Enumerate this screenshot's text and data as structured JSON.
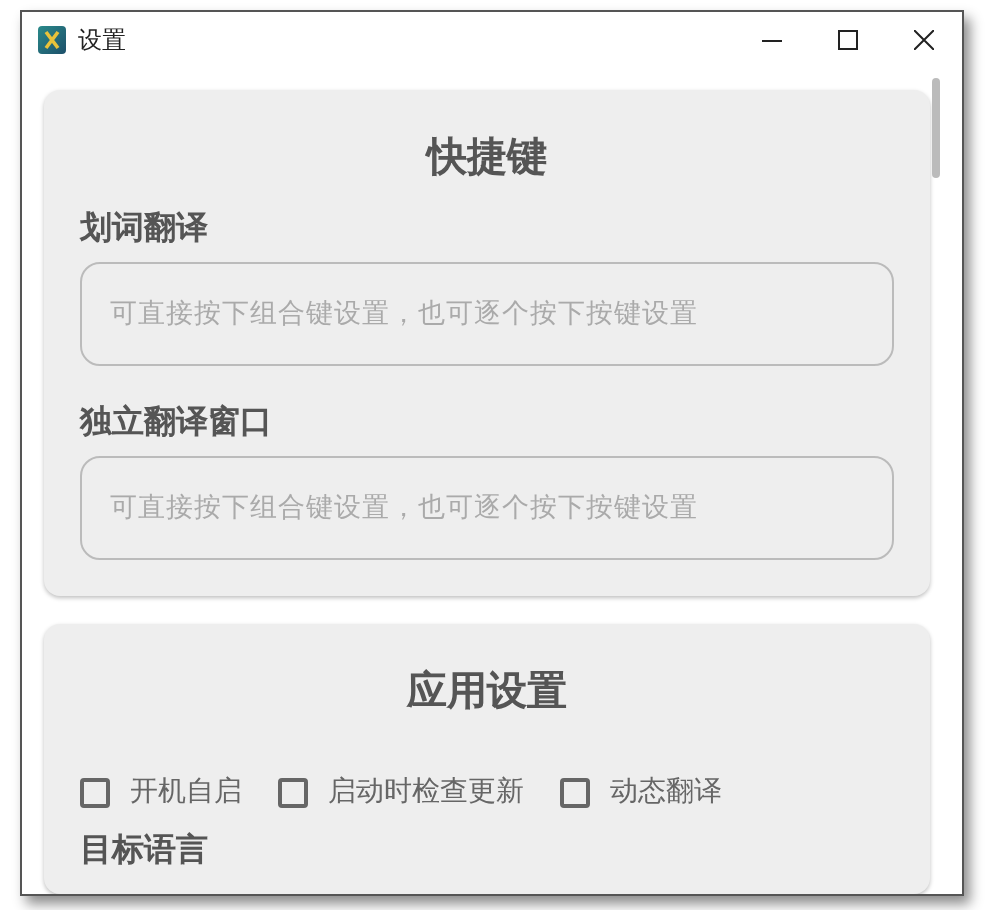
{
  "window": {
    "title": "设置"
  },
  "sections": [
    {
      "title": "快捷键",
      "fields": [
        {
          "label": "划词翻译",
          "placeholder": "可直接按下组合键设置，也可逐个按下按键设置"
        },
        {
          "label": "独立翻译窗口",
          "placeholder": "可直接按下组合键设置，也可逐个按下按键设置"
        }
      ]
    },
    {
      "title": "应用设置",
      "checkboxes": [
        {
          "label": "开机自启",
          "checked": false
        },
        {
          "label": "启动时检查更新",
          "checked": false
        },
        {
          "label": "动态翻译",
          "checked": false
        }
      ],
      "next_label": "目标语言"
    }
  ]
}
